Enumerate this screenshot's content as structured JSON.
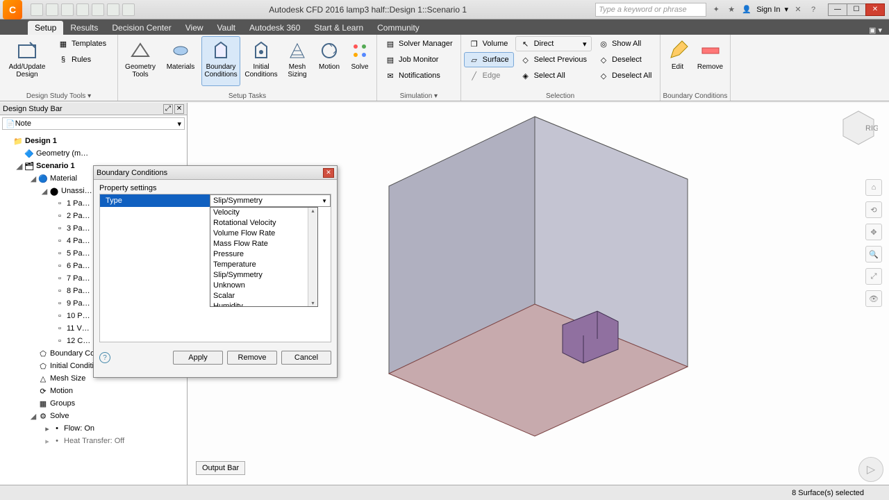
{
  "title": "Autodesk CFD 2016   lamp3 half::Design 1::Scenario 1",
  "search_placeholder": "Type a keyword or phrase",
  "signin": "Sign In",
  "ribbon_tabs": [
    "Setup",
    "Results",
    "Decision Center",
    "View",
    "Vault",
    "Autodesk 360",
    "Start & Learn",
    "Community"
  ],
  "active_tab": "Setup",
  "ribbon": {
    "group1_label": "Design Study Tools ▾",
    "addupdate": "Add/Update\nDesign",
    "templates": "Templates",
    "rules": "Rules",
    "group2_label": "Setup Tasks",
    "geometry_tools": "Geometry\nTools",
    "materials": "Materials",
    "boundary_conditions": "Boundary\nConditions",
    "initial_conditions": "Initial\nConditions",
    "mesh_sizing": "Mesh\nSizing",
    "motion": "Motion",
    "solve": "Solve",
    "group3_label": "Simulation ▾",
    "solver_manager": "Solver Manager",
    "job_monitor": "Job Monitor",
    "notifications": "Notifications",
    "group4_label": "Selection",
    "volume": "Volume",
    "surface": "Surface",
    "edge": "Edge",
    "direct": "Direct",
    "select_previous": "Select Previous",
    "select_all": "Select All",
    "show_all": "Show All",
    "deselect": "Deselect",
    "deselect_all": "Deselect All",
    "group5_label": "Boundary Conditions",
    "edit": "Edit",
    "remove": "Remove"
  },
  "dsb": {
    "title": "Design Study Bar",
    "note": "Note",
    "tree": {
      "design": "Design 1",
      "geometry": "Geometry (m…",
      "scenario": "Scenario 1",
      "material": "Material",
      "unassigned": "Unassi…",
      "parts": [
        "1 Pa…",
        "2 Pa…",
        "3 Pa…",
        "4 Pa…",
        "5 Pa…",
        "6 Pa…",
        "7 Pa…",
        "8 Pa…",
        "9 Pa…",
        "10 P…",
        "11 V…",
        "12 C…"
      ],
      "bc": "Boundary Conditions",
      "ic": "Initial Conditions",
      "mesh": "Mesh Size",
      "motion": "Motion",
      "groups": "Groups",
      "solve": "Solve",
      "flow": "Flow: On",
      "heat": "Heat Transfer: Off"
    }
  },
  "output_bar": "Output Bar",
  "dialog": {
    "title": "Boundary Conditions",
    "subtitle": "Property settings",
    "type_label": "Type",
    "type_value": "Slip/Symmetry",
    "options": [
      "Velocity",
      "Rotational Velocity",
      "Volume Flow Rate",
      "Mass Flow Rate",
      "Pressure",
      "Temperature",
      "Slip/Symmetry",
      "Unknown",
      "Scalar",
      "Humidity"
    ],
    "apply": "Apply",
    "remove": "Remove",
    "cancel": "Cancel"
  },
  "status": "8 Surface(s) selected"
}
